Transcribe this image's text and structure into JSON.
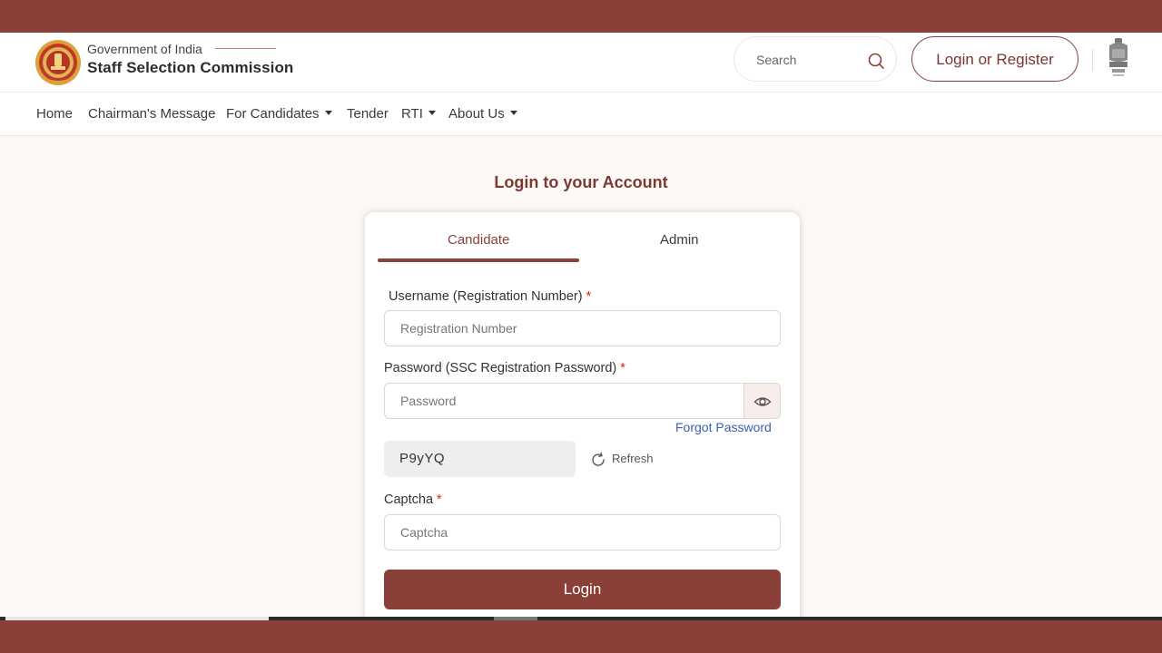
{
  "header": {
    "brand_small": "Government of India",
    "brand_name": "Staff Selection Commission",
    "search_placeholder": "Search",
    "login_register": "Login or Register",
    "logo_icon": "ssc-logo-icon",
    "emblem_icon": "national-emblem-icon"
  },
  "nav": {
    "items": [
      {
        "label": "Home"
      },
      {
        "label": "Chairman's Message"
      },
      {
        "label": "For Candidates"
      },
      {
        "label": "Tender"
      },
      {
        "label": "RTI"
      },
      {
        "label": "About Us"
      }
    ]
  },
  "login": {
    "title": "Login to your Account",
    "tabs": [
      {
        "label": "Candidate",
        "active": true
      },
      {
        "label": "Admin",
        "active": false
      }
    ],
    "username_label": "Username (Registration Number)",
    "username_placeholder": "Registration Number",
    "password_label": "Password (SSC Registration Password)",
    "password_placeholder": "Password",
    "required_mark": "*",
    "forgot_password": "Forgot Password",
    "captcha_value": "P9yYQ",
    "refresh_label": "Refresh",
    "captcha_label": "Captcha",
    "captcha_placeholder": "Captcha",
    "login_button": "Login"
  },
  "colors": {
    "brand": "#8a4039",
    "link": "#3b63b0",
    "required": "#dd2222"
  }
}
